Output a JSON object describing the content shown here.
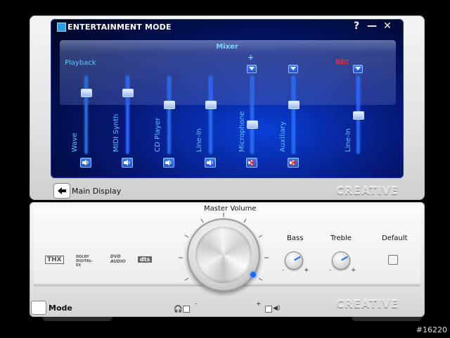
{
  "window": {
    "title": "ENTERTAINMENT MODE",
    "help": "?",
    "minimize": "—",
    "close": "✕"
  },
  "mixer": {
    "header": "Mixer",
    "playback_label": "Playback",
    "rec_label": "REC",
    "plus": "+",
    "channels": [
      {
        "label": "Wave",
        "level": 0.82,
        "muted": false
      },
      {
        "label": "MIDI Synth",
        "level": 0.82,
        "muted": false
      },
      {
        "label": "CD Player",
        "level": 0.7,
        "muted": false
      },
      {
        "label": "Line-In",
        "level": 0.7,
        "muted": false
      },
      {
        "label": "Microphone",
        "level": 0.4,
        "muted": true
      },
      {
        "label": "Auxiliary",
        "level": 0.7,
        "muted": true
      },
      {
        "label": "Line-In",
        "level": 0.5,
        "muted": false
      }
    ]
  },
  "nav": {
    "main_display": "Main Display",
    "mode": "Mode"
  },
  "brand": "CREATIVE",
  "controls": {
    "master_volume": "Master Volume",
    "bass": "Bass",
    "treble": "Treble",
    "default": "Default",
    "minus": "-",
    "plus": "+"
  },
  "logos": [
    "THX",
    "DOLBY DIGITAL-EX",
    "DVD AUDIO",
    "dts"
  ],
  "watermark": "#16220",
  "colors": {
    "accent": "#1e66ff",
    "label_blue": "#5ac4ff",
    "rec_red": "#ff2a2a"
  }
}
